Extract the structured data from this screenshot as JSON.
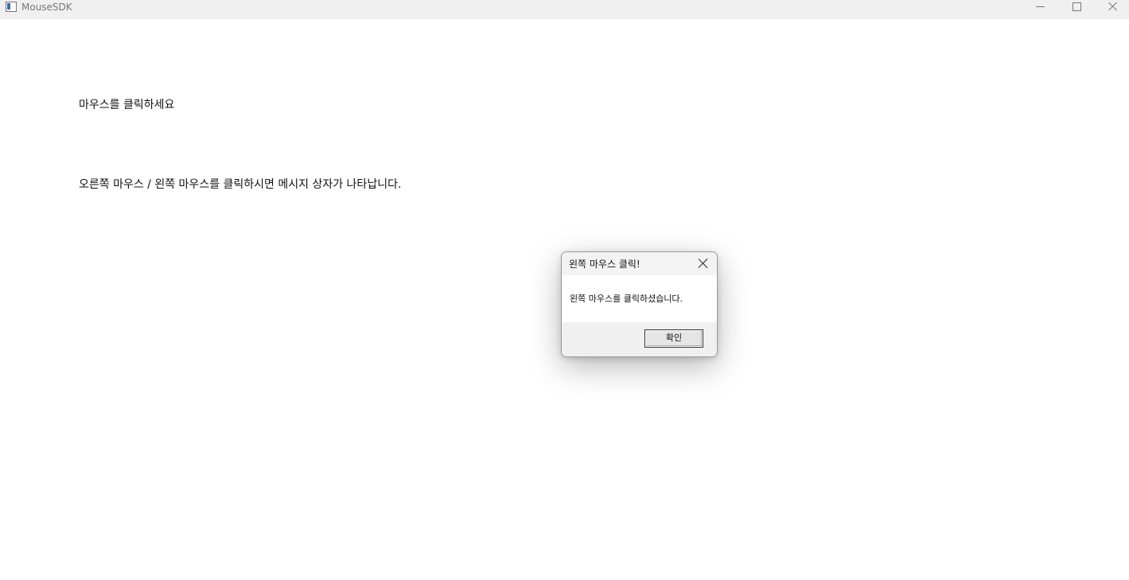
{
  "window": {
    "title": "MouseSDK",
    "icon": "app-window-icon",
    "controls": {
      "minimize": "minimize-icon",
      "maximize": "maximize-icon",
      "close": "close-icon"
    }
  },
  "main": {
    "instruction": "마우스를 클릭하세요",
    "description": "오른쪽 마우스 / 왼쪽 마우스를 클릭하시면 메시지 상자가 나타납니다."
  },
  "dialog": {
    "title": "왼쪽 마우스 클릭!",
    "message": "왼쪽 마우스를 클릭하셨습니다.",
    "ok_label": "확인"
  }
}
